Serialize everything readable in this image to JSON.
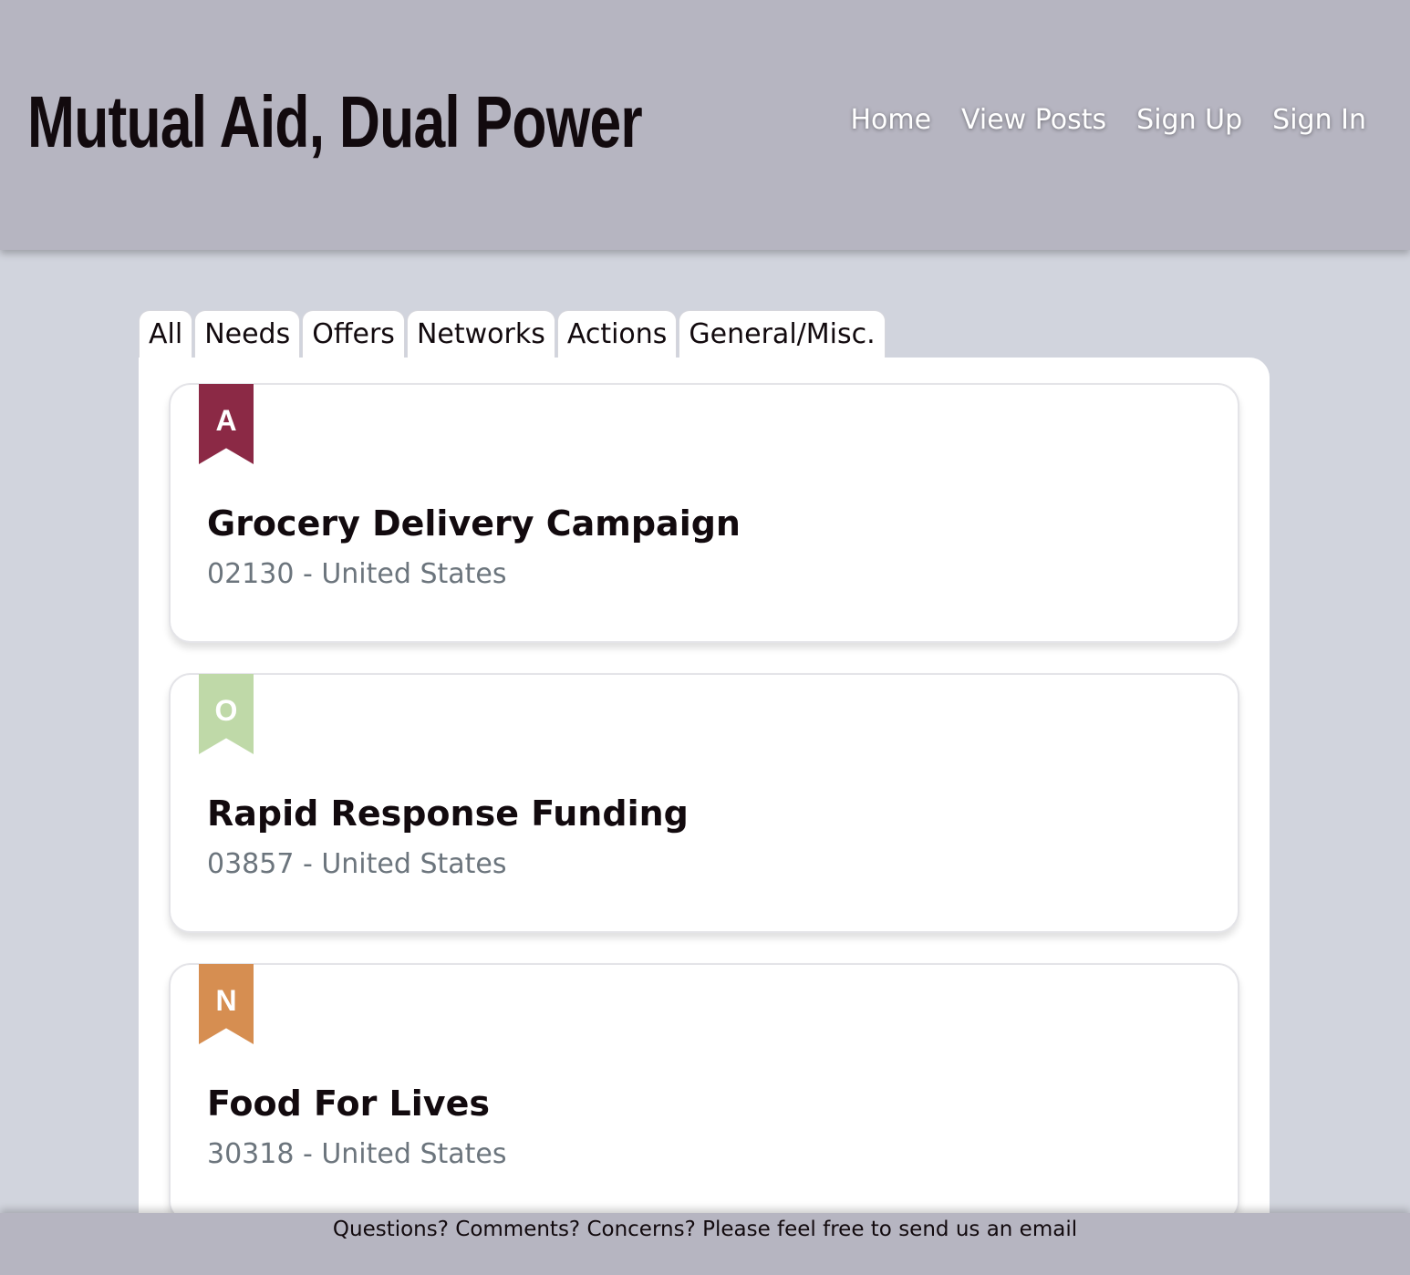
{
  "site": {
    "title": "Mutual Aid, Dual Power"
  },
  "nav": {
    "items": [
      {
        "label": "Home"
      },
      {
        "label": "View Posts"
      },
      {
        "label": "Sign Up"
      },
      {
        "label": "Sign In"
      }
    ]
  },
  "tabs": [
    {
      "label": "All"
    },
    {
      "label": "Needs"
    },
    {
      "label": "Offers"
    },
    {
      "label": "Networks"
    },
    {
      "label": "Actions"
    },
    {
      "label": "General/Misc."
    }
  ],
  "posts": [
    {
      "badge": "A",
      "badge_color": "#8b2945",
      "title": "Grocery Delivery Campaign",
      "location": "02130 - United States"
    },
    {
      "badge": "O",
      "badge_color": "#bfd9a8",
      "title": "Rapid Response Funding",
      "location": "03857 - United States"
    },
    {
      "badge": "N",
      "badge_color": "#d68e51",
      "title": "Food For Lives",
      "location": "30318 - United States"
    }
  ],
  "footer": {
    "text": "Questions? Comments? Concerns? Please feel free to ",
    "link_label": "send us an email"
  }
}
